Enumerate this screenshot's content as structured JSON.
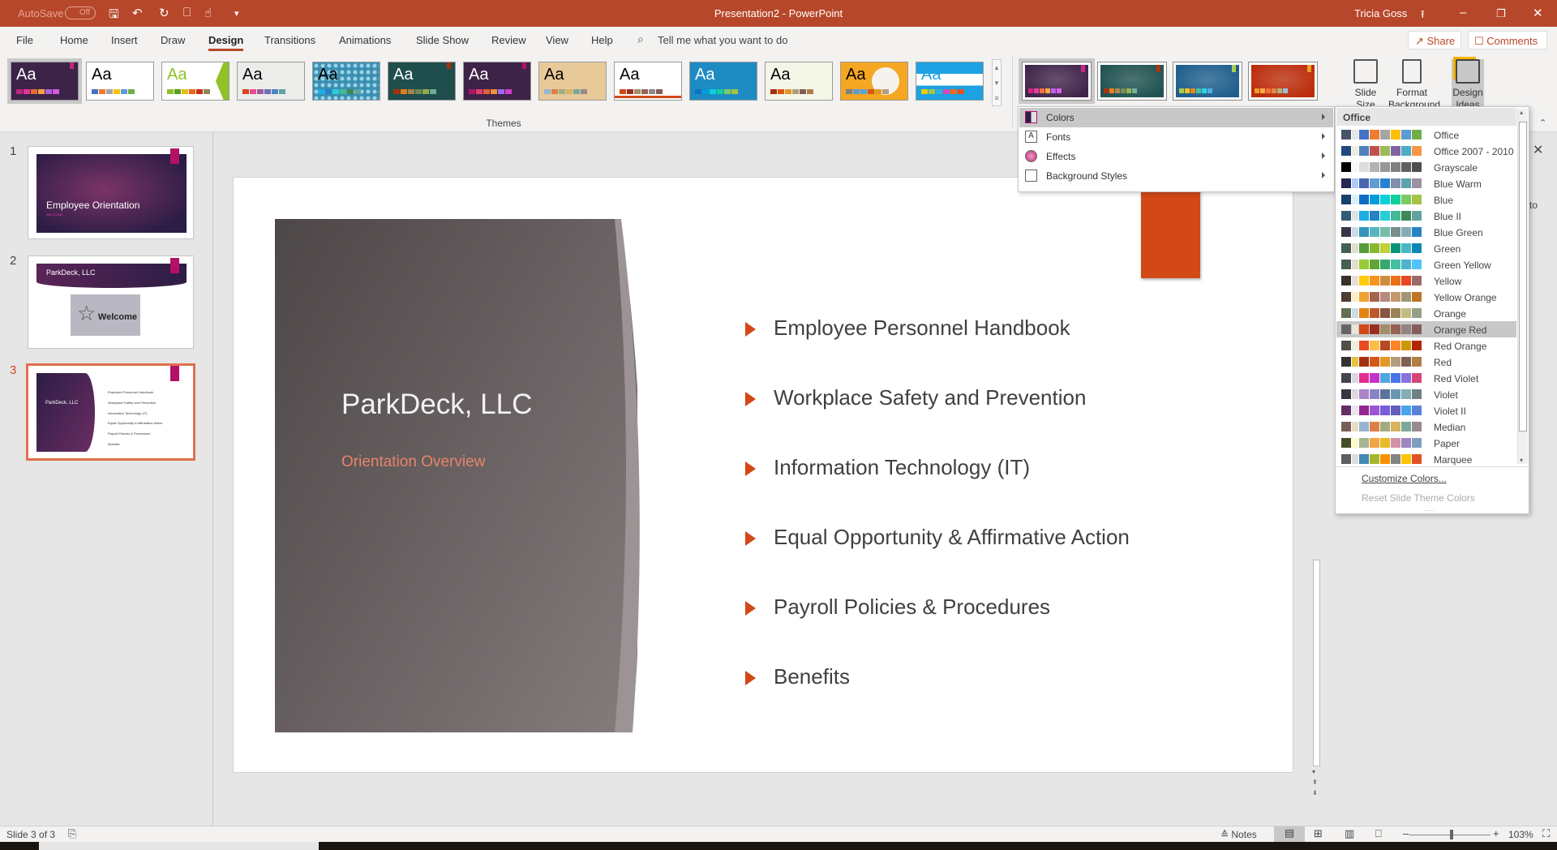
{
  "titlebar": {
    "autosave": "AutoSave",
    "autosave_state": "Off",
    "title": "Presentation2  -  PowerPoint",
    "user": "Tricia Goss"
  },
  "tabs": [
    "File",
    "Home",
    "Insert",
    "Draw",
    "Design",
    "Transitions",
    "Animations",
    "Slide Show",
    "Review",
    "View",
    "Help"
  ],
  "active_tab": "Design",
  "tell_me": "Tell me what you want to do",
  "share": "Share",
  "comments": "Comments",
  "themes_label": "Themes",
  "themes": [
    {
      "bg": "#3d2347",
      "fg": "#ffffff",
      "strip": [
        "#c0267e",
        "#e0389a",
        "#e66c37",
        "#f4a142",
        "#b15fe0",
        "#d15ae0"
      ],
      "tag": "#c0267e"
    },
    {
      "bg": "#ffffff",
      "fg": "#000000",
      "strip": [
        "#4472c4",
        "#ed7d31",
        "#a5a5a5",
        "#ffc000",
        "#5b9bd5",
        "#70ad47"
      ]
    },
    {
      "bg": "#ffffff",
      "fg": "#90c226",
      "strip": [
        "#90c226",
        "#54a021",
        "#e6b91e",
        "#e76618",
        "#c42f1a",
        "#918655"
      ],
      "edge": "#90c226"
    },
    {
      "bg": "#ececea",
      "fg": "#000000",
      "strip": [
        "#d34817",
        "#e84c93",
        "#a05a9a",
        "#6b6fb4",
        "#4c86c0",
        "#5ca5a4"
      ]
    },
    {
      "bg": "#3a8fb0",
      "fg": "#000000",
      "strip": [
        "#1cade4",
        "#2683c6",
        "#27ced7",
        "#42ba97",
        "#3e8853",
        "#62a39f"
      ],
      "pattern": true
    },
    {
      "bg": "#1f4e4d",
      "fg": "#ffffff",
      "strip": [
        "#a53010",
        "#de7e18",
        "#9f8351",
        "#728653",
        "#92aa4c",
        "#6aac91"
      ],
      "tag": "#a53010"
    },
    {
      "bg": "#3d2347",
      "fg": "#ffffff",
      "strip": [
        "#b31166",
        "#e33d6f",
        "#e45f3c",
        "#e9943a",
        "#9b6bf2",
        "#d53dd0"
      ],
      "tag": "#b31166"
    },
    {
      "bg": "#e8c99a",
      "fg": "#000000",
      "strip": [
        "#94b6d2",
        "#dd8047",
        "#a5ab81",
        "#d8b25c",
        "#7ba79d",
        "#968c8c"
      ]
    },
    {
      "bg": "#ffffff",
      "fg": "#000000",
      "strip": [
        "#d34817",
        "#9b2d1f",
        "#a28e6a",
        "#956251",
        "#918485",
        "#855d5d"
      ],
      "line": "#d34817"
    },
    {
      "bg": "#1e8bc3",
      "fg": "#ffffff",
      "strip": [
        "#0f6fc6",
        "#009dd9",
        "#0bd0d9",
        "#10cf9b",
        "#7cca62",
        "#a5c249"
      ]
    },
    {
      "bg": "#f4f6e8",
      "fg": "#000000",
      "strip": [
        "#a5300f",
        "#d55816",
        "#e19825",
        "#b19c7d",
        "#7f5f52",
        "#b27d49"
      ]
    },
    {
      "bg": "#f5a623",
      "fg": "#000000",
      "strip": [
        "#7f7f7f",
        "#5b9bd5",
        "#4ea6dc",
        "#d55816",
        "#e19825",
        "#b19c7d"
      ]
    },
    {
      "bg": "#1da1e2",
      "fg": "#1da1e2",
      "strip": [
        "#f0cd00",
        "#a5c249",
        "#30b0e0",
        "#d84ab8",
        "#f26b1d",
        "#e54f1a"
      ],
      "band": true
    }
  ],
  "variants": [
    {
      "bg": "#3d2347",
      "tag": "#c0267e",
      "strip": [
        "#c0267e",
        "#e0389a",
        "#e66c37",
        "#f4a142",
        "#b15fe0",
        "#d15ae0"
      ]
    },
    {
      "bg": "#1f4e4d",
      "tag": "#a53010",
      "strip": [
        "#a53010",
        "#de7e18",
        "#9f8351",
        "#728653",
        "#92aa4c",
        "#6aac91"
      ]
    },
    {
      "bg": "#1e5a86",
      "tag": "#a5c249",
      "strip": [
        "#a5c249",
        "#e6b91e",
        "#de7e18",
        "#42ba97",
        "#27ced7",
        "#4ea6dc"
      ]
    },
    {
      "bg": "#b32b0c",
      "tag": "#e19825",
      "strip": [
        "#e19825",
        "#f4a142",
        "#e66c37",
        "#dd8047",
        "#a5ab81",
        "#94b6d2"
      ]
    }
  ],
  "ribbon_buttons": {
    "slide_size": "Slide Size",
    "format_background": "Format Background",
    "design_ideas": "Design Ideas"
  },
  "variant_menu": [
    {
      "label": "Colors",
      "icon": "colors-icon"
    },
    {
      "label": "Fonts",
      "icon": "fonts-icon"
    },
    {
      "label": "Effects",
      "icon": "effects-icon"
    },
    {
      "label": "Background Styles",
      "icon": "background-styles-icon"
    }
  ],
  "colors_menu": {
    "header": "Office",
    "selected": "Orange Red",
    "schemes": [
      {
        "name": "Office",
        "c": [
          "#44546a",
          "#e7e6e6",
          "#4472c4",
          "#ed7d31",
          "#a5a5a5",
          "#ffc000",
          "#5b9bd5",
          "#70ad47"
        ]
      },
      {
        "name": "Office 2007 - 2010",
        "c": [
          "#1f497d",
          "#eeece1",
          "#4f81bd",
          "#c0504d",
          "#9bbb59",
          "#8064a2",
          "#4bacc6",
          "#f79646"
        ]
      },
      {
        "name": "Grayscale",
        "c": [
          "#000000",
          "#f8f8f8",
          "#dddddd",
          "#b2b2b2",
          "#969696",
          "#808080",
          "#5f5f5f",
          "#4d4d4d"
        ]
      },
      {
        "name": "Blue Warm",
        "c": [
          "#242852",
          "#accbf9",
          "#4a66ac",
          "#629dd1",
          "#297fd5",
          "#7f8fa9",
          "#5aa2ae",
          "#9d90a0"
        ]
      },
      {
        "name": "Blue",
        "c": [
          "#17406d",
          "#dbeff9",
          "#0f6fc6",
          "#009dd9",
          "#0bd0d9",
          "#10cf9b",
          "#7cca62",
          "#a5c249"
        ]
      },
      {
        "name": "Blue II",
        "c": [
          "#335b74",
          "#dfe3e5",
          "#1cade4",
          "#2683c6",
          "#27ced7",
          "#42ba97",
          "#3e8853",
          "#62a39f"
        ]
      },
      {
        "name": "Blue Green",
        "c": [
          "#373545",
          "#cedbe6",
          "#3494ba",
          "#58b6c0",
          "#75bda7",
          "#7a8c8e",
          "#84acb6",
          "#2683c6"
        ]
      },
      {
        "name": "Green",
        "c": [
          "#455f51",
          "#e3ded1",
          "#549e39",
          "#8ab833",
          "#c0cf3a",
          "#029676",
          "#4ab5c4",
          "#0989b1"
        ]
      },
      {
        "name": "Green Yellow",
        "c": [
          "#455f51",
          "#e3ded1",
          "#99cb38",
          "#63a537",
          "#37a76f",
          "#44c1a3",
          "#4eb3cf",
          "#51c3f9"
        ]
      },
      {
        "name": "Yellow",
        "c": [
          "#39302a",
          "#e5dedb",
          "#ffca08",
          "#f8931d",
          "#ce8d3e",
          "#ec7016",
          "#e64823",
          "#9c6a6a"
        ]
      },
      {
        "name": "Yellow Orange",
        "c": [
          "#4e3b30",
          "#fbeec9",
          "#f0a22e",
          "#a5644e",
          "#b58b80",
          "#c3986d",
          "#a19574",
          "#c17529"
        ]
      },
      {
        "name": "Orange",
        "c": [
          "#637052",
          "#ccddea",
          "#e48312",
          "#bd582c",
          "#865640",
          "#9b8357",
          "#c2bc80",
          "#94a088"
        ]
      },
      {
        "name": "Orange Red",
        "c": [
          "#696464",
          "#e9e5dc",
          "#d34817",
          "#9b2d1f",
          "#a28e6a",
          "#956251",
          "#918485",
          "#855d5d"
        ]
      },
      {
        "name": "Red Orange",
        "c": [
          "#505046",
          "#eeece1",
          "#e84c22",
          "#ffbd47",
          "#b64926",
          "#ff8427",
          "#cc9900",
          "#b22600"
        ]
      },
      {
        "name": "Red",
        "c": [
          "#323232",
          "#e5c243",
          "#a5300f",
          "#d55816",
          "#e19825",
          "#b19c7d",
          "#7f5f52",
          "#b27d49"
        ]
      },
      {
        "name": "Red Violet",
        "c": [
          "#454551",
          "#d8d9dc",
          "#e32d91",
          "#c830cc",
          "#4ea6dc",
          "#4775e7",
          "#8971e1",
          "#d54773"
        ]
      },
      {
        "name": "Violet",
        "c": [
          "#373545",
          "#dcd8dc",
          "#ad84c6",
          "#8784c7",
          "#5d739a",
          "#6997af",
          "#84acb6",
          "#6f8183"
        ]
      },
      {
        "name": "Violet II",
        "c": [
          "#632e62",
          "#eae5eb",
          "#92278f",
          "#9b57d3",
          "#755dd9",
          "#665eb8",
          "#45a5ed",
          "#5982db"
        ]
      },
      {
        "name": "Median",
        "c": [
          "#775f55",
          "#ebddc3",
          "#94b6d2",
          "#dd8047",
          "#a5ab81",
          "#d8b25c",
          "#7ba79d",
          "#968c8c"
        ]
      },
      {
        "name": "Paper",
        "c": [
          "#444d26",
          "#fefac9",
          "#a5b592",
          "#f3a447",
          "#e7bc29",
          "#d092a7",
          "#9c85c0",
          "#809ec2"
        ]
      },
      {
        "name": "Marquee",
        "c": [
          "#5e5e5e",
          "#dddddd",
          "#418ab3",
          "#a6b727",
          "#f69200",
          "#838383",
          "#fec306",
          "#df5327"
        ]
      }
    ],
    "customize": "Customize Colors...",
    "reset": "Reset Slide Theme Colors"
  },
  "thumbnails": [
    {
      "num": "1",
      "title": "Employee Orientation",
      "subtitle": "WELCOME"
    },
    {
      "num": "2",
      "title": "ParkDeck, LLC",
      "image": "Welcome"
    },
    {
      "num": "3",
      "title": "ParkDeck, LLC",
      "bullets": [
        "Employee Personnel Handbook",
        "Workplace Safety and Prevention",
        "Information Technology (IT)",
        "Equal Opportunity & Affirmative Action",
        "Payroll Policies & Procedures",
        "Benefits"
      ]
    }
  ],
  "slide": {
    "title": "ParkDeck, LLC",
    "subtitle": "Orientation Overview",
    "bullets": [
      "Employee Personnel Handbook",
      "Workplace Safety and Prevention",
      "Information Technology (IT)",
      "Equal Opportunity & Affirmative Action",
      "Payroll Policies & Procedures",
      "Benefits"
    ],
    "accent": "#d34817"
  },
  "side_pane_partial": "to",
  "status": {
    "slide": "Slide 3 of 3",
    "notes": "Notes",
    "zoom": "103%",
    "zoom_level_percent": 103
  }
}
